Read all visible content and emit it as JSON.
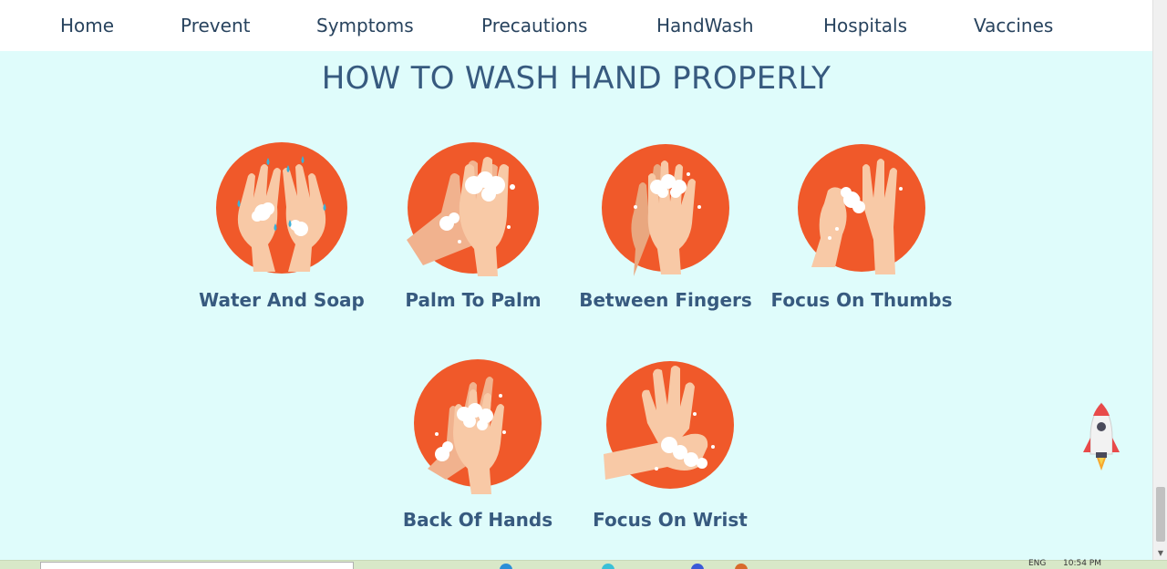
{
  "nav": {
    "items": [
      {
        "label": "Home"
      },
      {
        "label": "Prevent"
      },
      {
        "label": "Symptoms"
      },
      {
        "label": "Precautions"
      },
      {
        "label": "HandWash"
      },
      {
        "label": "Hospitals"
      },
      {
        "label": "Vaccines"
      }
    ]
  },
  "main": {
    "title": "HOW TO WASH HAND PROPERLY",
    "steps": [
      {
        "label": "Water And Soap",
        "icon": "water-and-soap-icon"
      },
      {
        "label": "Palm To Palm",
        "icon": "palm-to-palm-icon"
      },
      {
        "label": "Between Fingers",
        "icon": "between-fingers-icon"
      },
      {
        "label": "Focus On Thumbs",
        "icon": "focus-on-thumbs-icon"
      },
      {
        "label": "Back Of Hands",
        "icon": "back-of-hands-icon"
      },
      {
        "label": "Focus On Wrist",
        "icon": "focus-on-wrist-icon"
      }
    ]
  },
  "colors": {
    "background": "#dffcfb",
    "accent_circle": "#f0592a",
    "skin": "#f8c9a6",
    "text": "#375a7f",
    "nav_text": "#28435e"
  },
  "scroll_top_button": {
    "icon": "rocket-icon"
  },
  "taskbar": {
    "lang": "ENG",
    "time": "10:54 PM"
  }
}
